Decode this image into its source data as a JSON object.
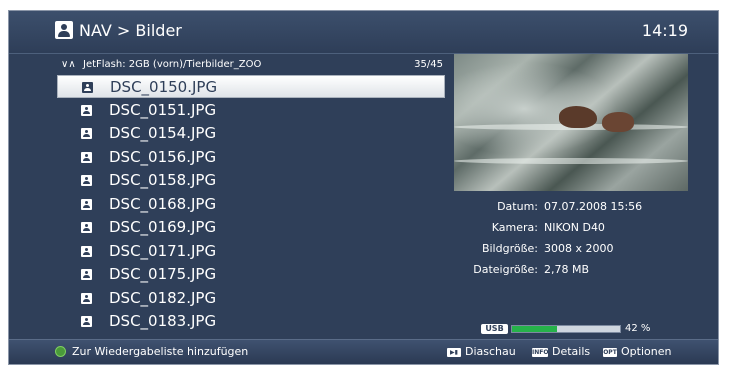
{
  "header": {
    "title": "NAV > Bilder",
    "time": "14:19"
  },
  "path": {
    "arrows": "∨∧",
    "text": "JetFlash: 2GB (vorn)/Tierbilder_ZOO",
    "count": "35/45"
  },
  "files": [
    {
      "name": "DSC_0150.JPG",
      "selected": true
    },
    {
      "name": "DSC_0151.JPG"
    },
    {
      "name": "DSC_0154.JPG"
    },
    {
      "name": "DSC_0156.JPG"
    },
    {
      "name": "DSC_0158.JPG"
    },
    {
      "name": "DSC_0168.JPG"
    },
    {
      "name": "DSC_0169.JPG"
    },
    {
      "name": "DSC_0171.JPG"
    },
    {
      "name": "DSC_0175.JPG"
    },
    {
      "name": "DSC_0182.JPG"
    },
    {
      "name": "DSC_0183.JPG"
    }
  ],
  "details": {
    "date_label": "Datum:",
    "date_value": "07.07.2008 15:56",
    "camera_label": "Kamera:",
    "camera_value": "NIKON D40",
    "size_label": "Bildgröße:",
    "size_value": "3008 x 2000",
    "filesize_label": "Dateigröße:",
    "filesize_value": "2,78 MB"
  },
  "storage": {
    "device_label": "USB",
    "used_percent": 42,
    "percent_text": "42 %"
  },
  "footer": {
    "add_label": "Zur Wiedergabeliste hinzufügen",
    "play_key": "▶▮",
    "slideshow_label": "Diaschau",
    "info_key": "INFO",
    "details_label": "Details",
    "opt_key": "OPT",
    "options_label": "Optionen"
  },
  "colors": {
    "background": "#2f3f59",
    "selection": "#ffffff",
    "usb_fill": "#26b24a",
    "green_key": "#4a9a3a"
  },
  "icons": {
    "header": "picture-icon",
    "file": "picture-file-icon",
    "usb": "usb-icon",
    "green_button": "green-button-icon"
  }
}
